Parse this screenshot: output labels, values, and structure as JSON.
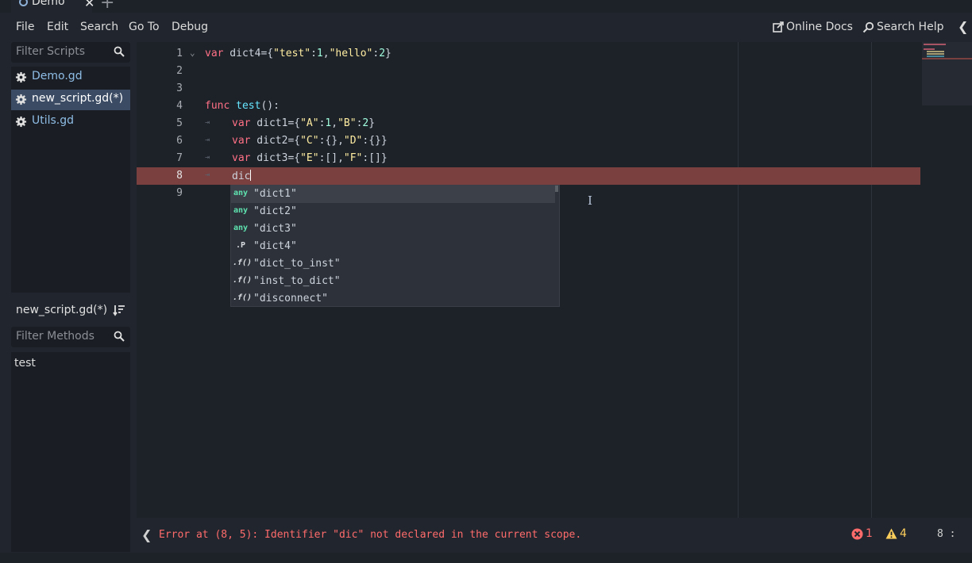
{
  "tab": {
    "title": "Demo",
    "close": "✕",
    "add": "+"
  },
  "menu": {
    "items": [
      "File",
      "Edit",
      "Search",
      "Go To",
      "Debug"
    ],
    "online_docs": "Online Docs",
    "search_help": "Search Help",
    "collapse": "❮"
  },
  "scripts": {
    "filter_placeholder": "Filter Scripts",
    "items": [
      {
        "name": "Demo.gd"
      },
      {
        "name": "new_script.gd(*)"
      },
      {
        "name": "Utils.gd"
      }
    ]
  },
  "methods": {
    "current_script": "new_script.gd(*)",
    "filter_placeholder": "Filter Methods",
    "items": [
      "test"
    ]
  },
  "code": {
    "lines": [
      "1",
      "2",
      "3",
      "4",
      "5",
      "6",
      "7",
      "8",
      "9"
    ],
    "line1": {
      "kw": "var",
      "rest": " dict4={",
      "s1": "\"test\"",
      "c1": ":",
      "n1": "1",
      "comma": ",",
      "s2": "\"hello\"",
      "c2": ":",
      "n2": "2",
      "end": "}"
    },
    "line4": {
      "kw": "func",
      "fn": "test",
      "rest": "():"
    },
    "line5": {
      "kw": "var",
      "rest": " dict1={",
      "s1": "\"A\"",
      "c1": ":",
      "n1": "1",
      "comma": ",",
      "s2": "\"B\"",
      "c2": ":",
      "n2": "2",
      "end": "}"
    },
    "line6": {
      "kw": "var",
      "rest": " dict2={",
      "s1": "\"C\"",
      "c1": ":{},",
      "s2": "\"D\"",
      "c2": ":{}}"
    },
    "line7": {
      "kw": "var",
      "rest": " dict3={",
      "s1": "\"E\"",
      "c1": ":[],",
      "s2": "\"F\"",
      "c2": ":[]}"
    },
    "line8": {
      "text": "dic"
    },
    "tab_glyph": "⇥"
  },
  "autocomplete": {
    "items": [
      {
        "icon": "any",
        "label": "\"dict1\""
      },
      {
        "icon": "any",
        "label": "\"dict2\""
      },
      {
        "icon": "any",
        "label": "\"dict3\""
      },
      {
        "icon": ".P",
        "label": "\"dict4\""
      },
      {
        "icon": ".f()",
        "label": "\"dict_to_inst\""
      },
      {
        "icon": ".f()",
        "label": "\"inst_to_dict\""
      },
      {
        "icon": ".f()",
        "label": "\"disconnect\""
      }
    ]
  },
  "status": {
    "collapse": "❮",
    "error": "Error at (8, 5): Identifier \"dic\" not declared in the current scope.",
    "error_count": "1",
    "warning_count": "4",
    "position": "8 :"
  },
  "colors": {
    "keyword": "#ff7085",
    "function": "#66e6ff",
    "string": "#ffeda1",
    "number": "#a1ffe0",
    "error_line": "#7a3f3f",
    "error_text": "#ff6b6b",
    "warning": "#ffcf5c"
  }
}
